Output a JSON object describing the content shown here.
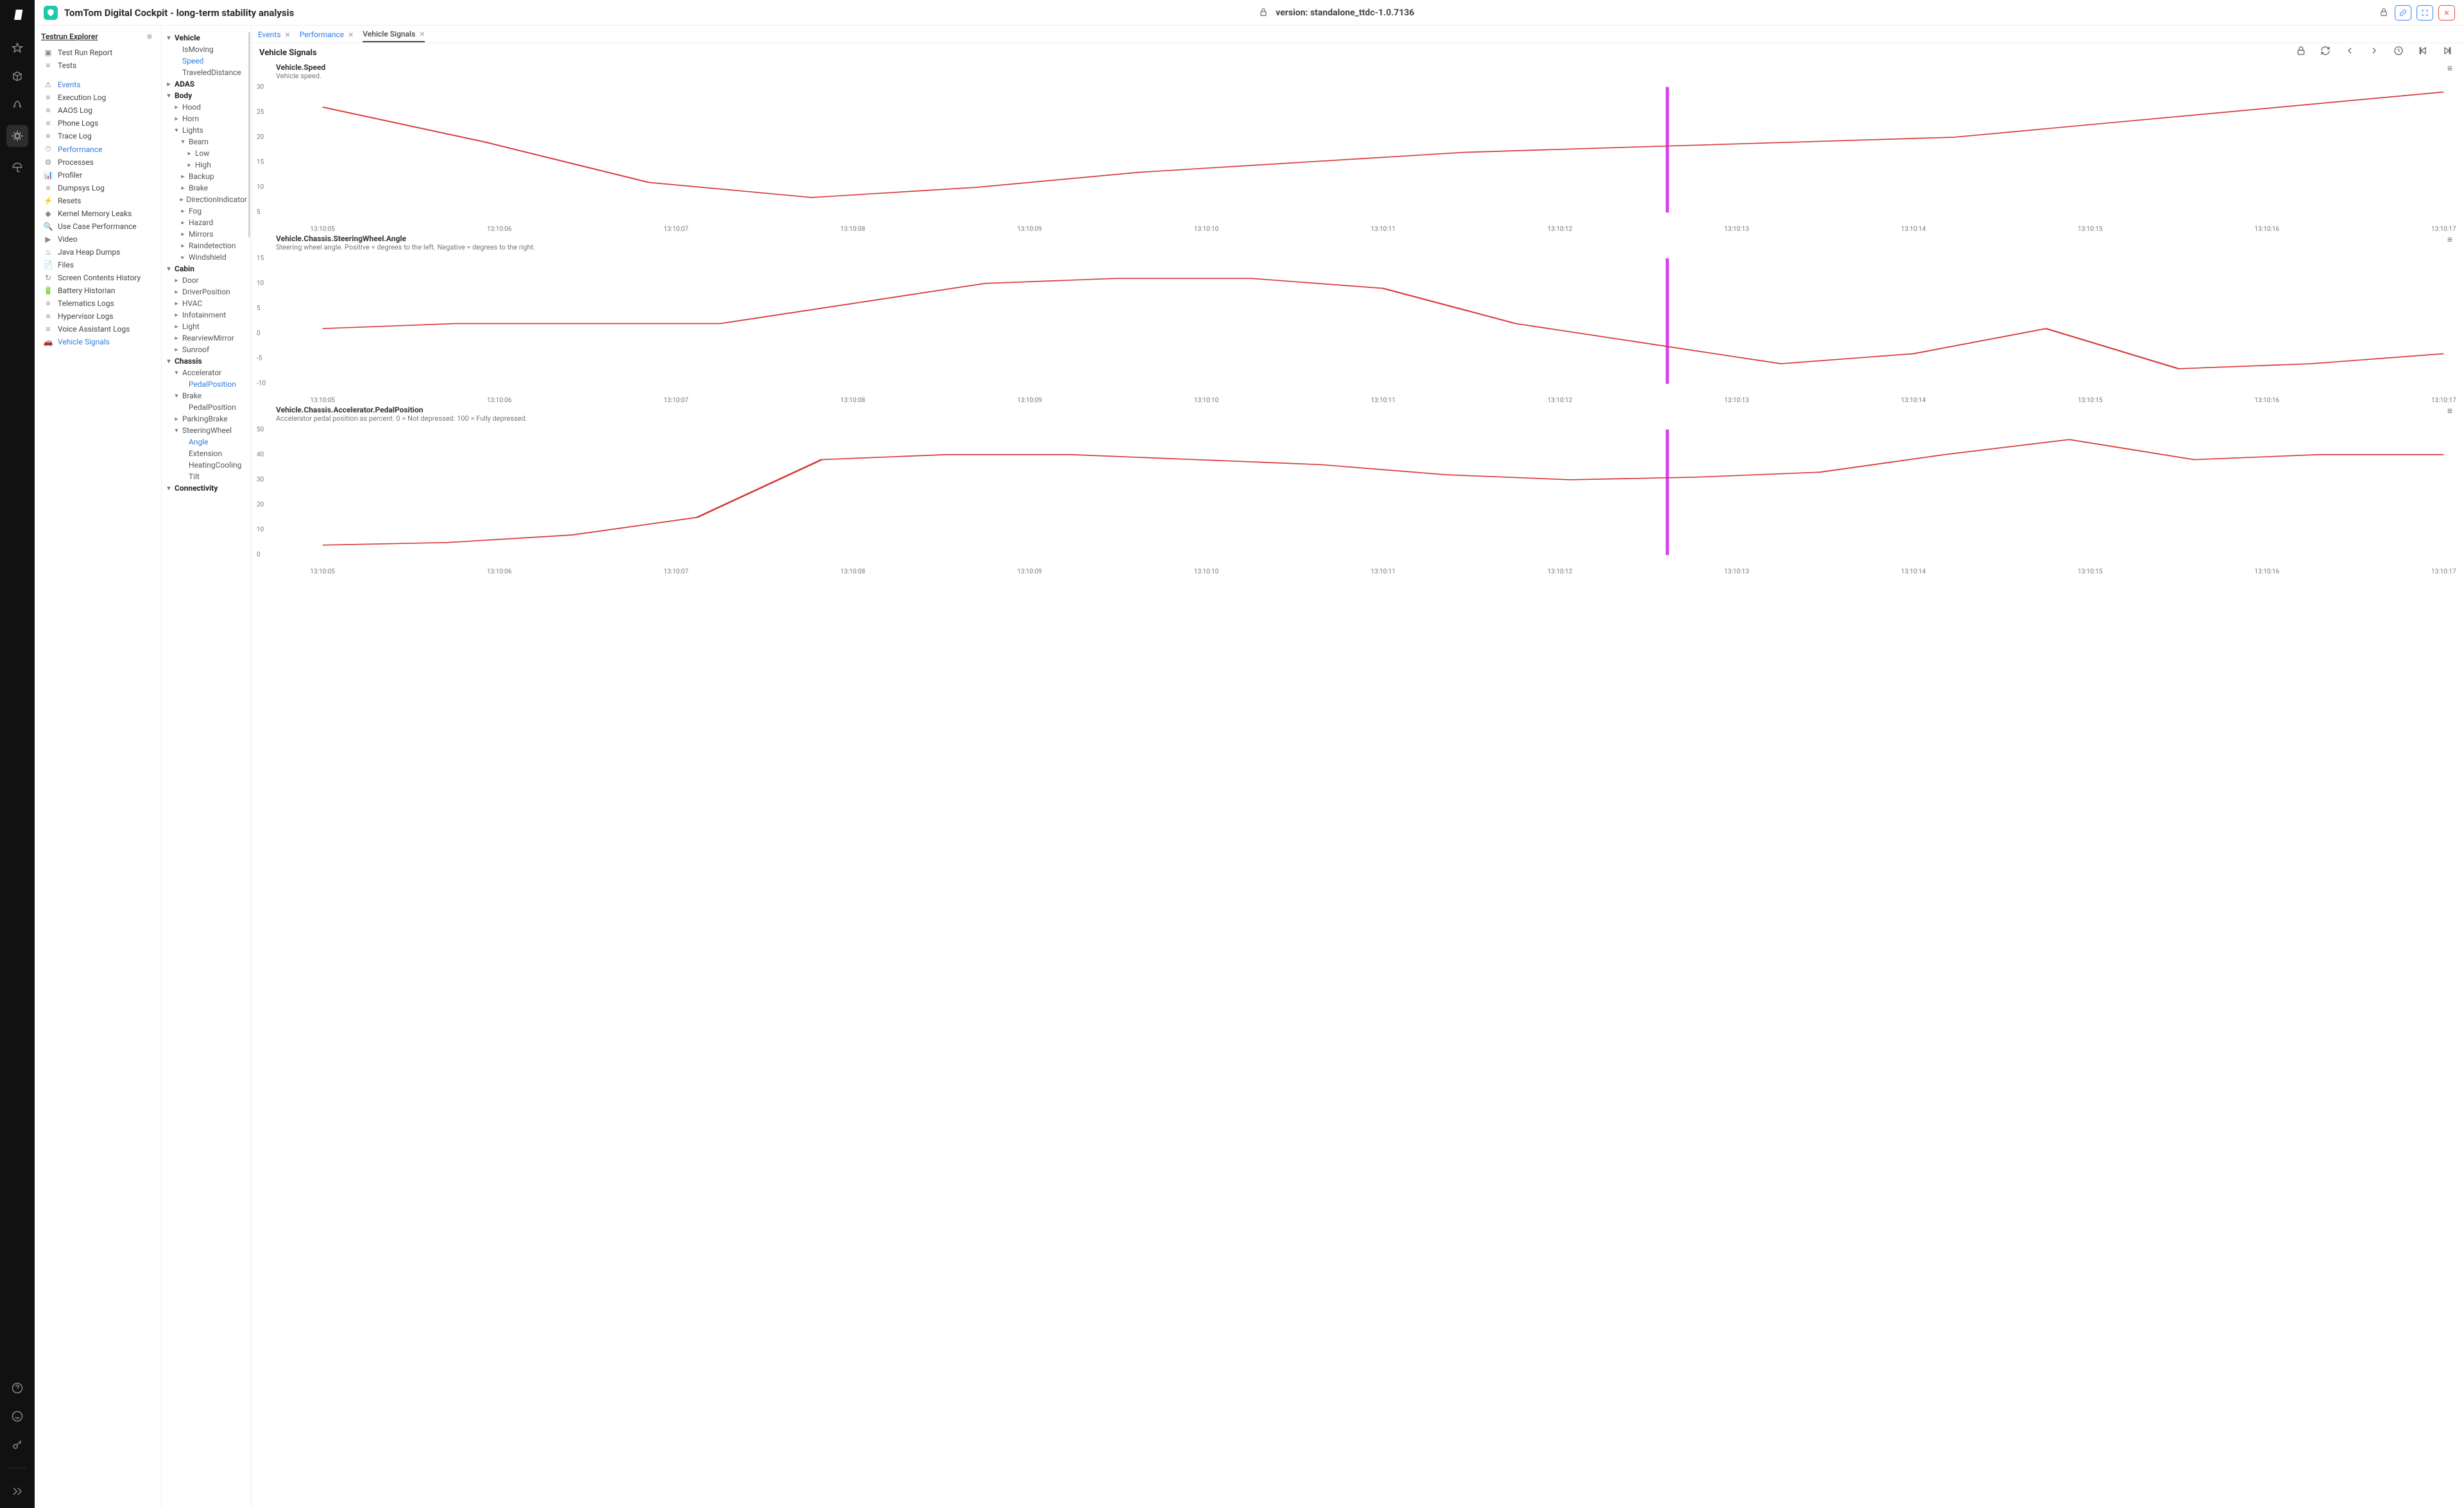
{
  "header": {
    "title": "TomTom Digital Cockpit - long-term stability analysis",
    "version": "version: standalone_ttdc-1.0.7136"
  },
  "rail_icons": [
    "star",
    "package",
    "rocket",
    "bug",
    "umbrella",
    "help",
    "smile",
    "key",
    "expand"
  ],
  "sidebar": {
    "section": "Testrun Explorer",
    "group1": [
      {
        "icon": "▣",
        "label": "Test Run Report"
      },
      {
        "icon": "≡",
        "label": "Tests"
      }
    ],
    "group2": [
      {
        "icon": "⚠",
        "label": "Events",
        "active": true
      },
      {
        "icon": "≡",
        "label": "Execution Log"
      },
      {
        "icon": "≡",
        "label": "AAOS Log"
      },
      {
        "icon": "≡",
        "label": "Phone Logs"
      },
      {
        "icon": "≡",
        "label": "Trace Log"
      },
      {
        "icon": "⏱",
        "label": "Performance",
        "active": true
      },
      {
        "icon": "⚙",
        "label": "Processes"
      },
      {
        "icon": "📊",
        "label": "Profiler"
      },
      {
        "icon": "≡",
        "label": "Dumpsys Log"
      },
      {
        "icon": "⚡",
        "label": "Resets"
      },
      {
        "icon": "◆",
        "label": "Kernel Memory Leaks"
      },
      {
        "icon": "🔍",
        "label": "Use Case Performance"
      },
      {
        "icon": "▶",
        "label": "Video"
      },
      {
        "icon": "♨",
        "label": "Java Heap Dumps"
      },
      {
        "icon": "📄",
        "label": "Files"
      },
      {
        "icon": "↻",
        "label": "Screen Contents History"
      },
      {
        "icon": "🔋",
        "label": "Battery Historian"
      },
      {
        "icon": "≡",
        "label": "Telematics Logs"
      },
      {
        "icon": "≡",
        "label": "Hypervisor Logs"
      },
      {
        "icon": "≡",
        "label": "Voice Assistant Logs"
      },
      {
        "icon": "🚗",
        "label": "Vehicle Signals",
        "active": true
      }
    ]
  },
  "tabs": [
    {
      "label": "Events",
      "active": false
    },
    {
      "label": "Performance",
      "active": false
    },
    {
      "label": "Vehicle Signals",
      "active": true
    }
  ],
  "section_title": "Vehicle Signals",
  "tree": [
    {
      "l": 0,
      "exp": "▾",
      "label": "Vehicle",
      "bold": true
    },
    {
      "l": 1,
      "exp": "",
      "label": "IsMoving"
    },
    {
      "l": 1,
      "exp": "",
      "label": "Speed",
      "active": true
    },
    {
      "l": 1,
      "exp": "",
      "label": "TraveledDistance"
    },
    {
      "l": 0,
      "exp": "▸",
      "label": "ADAS",
      "bold": true
    },
    {
      "l": 0,
      "exp": "▾",
      "label": "Body",
      "bold": true
    },
    {
      "l": 1,
      "exp": "▸",
      "label": "Hood"
    },
    {
      "l": 1,
      "exp": "▸",
      "label": "Horn"
    },
    {
      "l": 1,
      "exp": "▾",
      "label": "Lights"
    },
    {
      "l": 2,
      "exp": "▾",
      "label": "Beam"
    },
    {
      "l": 3,
      "exp": "▸",
      "label": "Low"
    },
    {
      "l": 3,
      "exp": "▸",
      "label": "High"
    },
    {
      "l": 2,
      "exp": "▸",
      "label": "Backup"
    },
    {
      "l": 2,
      "exp": "▸",
      "label": "Brake"
    },
    {
      "l": 2,
      "exp": "▸",
      "label": "DirectionIndicator"
    },
    {
      "l": 2,
      "exp": "▸",
      "label": "Fog"
    },
    {
      "l": 2,
      "exp": "▸",
      "label": "Hazard"
    },
    {
      "l": 2,
      "exp": "▸",
      "label": "Mirrors"
    },
    {
      "l": 2,
      "exp": "▸",
      "label": "Raindetection"
    },
    {
      "l": 2,
      "exp": "▸",
      "label": "Windshield"
    },
    {
      "l": 0,
      "exp": "▾",
      "label": "Cabin",
      "bold": true
    },
    {
      "l": 1,
      "exp": "▸",
      "label": "Door"
    },
    {
      "l": 1,
      "exp": "▸",
      "label": "DriverPosition"
    },
    {
      "l": 1,
      "exp": "▸",
      "label": "HVAC"
    },
    {
      "l": 1,
      "exp": "▸",
      "label": "Infotainment"
    },
    {
      "l": 1,
      "exp": "▸",
      "label": "Light"
    },
    {
      "l": 1,
      "exp": "▸",
      "label": "RearviewMirror"
    },
    {
      "l": 1,
      "exp": "▸",
      "label": "Sunroof"
    },
    {
      "l": 0,
      "exp": "▾",
      "label": "Chassis",
      "bold": true
    },
    {
      "l": 1,
      "exp": "▾",
      "label": "Accelerator"
    },
    {
      "l": 2,
      "exp": "",
      "label": "PedalPosition",
      "active": true
    },
    {
      "l": 1,
      "exp": "▾",
      "label": "Brake"
    },
    {
      "l": 2,
      "exp": "",
      "label": "PedalPosition"
    },
    {
      "l": 1,
      "exp": "▸",
      "label": "ParkingBrake"
    },
    {
      "l": 1,
      "exp": "▾",
      "label": "SteeringWheel"
    },
    {
      "l": 2,
      "exp": "",
      "label": "Angle",
      "active": true
    },
    {
      "l": 2,
      "exp": "",
      "label": "Extension"
    },
    {
      "l": 2,
      "exp": "",
      "label": "HeatingCooling"
    },
    {
      "l": 2,
      "exp": "",
      "label": "Tilt"
    },
    {
      "l": 0,
      "exp": "▾",
      "label": "Connectivity",
      "bold": true
    }
  ],
  "x_labels": [
    "13:10:05",
    "13:10:06",
    "13:10:07",
    "13:10:08",
    "13:10:09",
    "13:10:10",
    "13:10:11",
    "13:10:12",
    "13:10:13",
    "13:10:14",
    "13:10:15",
    "13:10:16",
    "13:10:17"
  ],
  "cursor_x_frac": 0.634,
  "chart_data": [
    {
      "type": "line",
      "title": "Vehicle.Speed",
      "subtitle": "Vehicle speed.",
      "ylim": [
        5,
        30
      ],
      "yticks": [
        5,
        10,
        15,
        20,
        25,
        30
      ],
      "x": [
        "13:10:05",
        "13:10:06",
        "13:10:07",
        "13:10:08",
        "13:10:09",
        "13:10:10",
        "13:10:11",
        "13:10:12",
        "13:10:13",
        "13:10:14",
        "13:10:15",
        "13:10:16",
        "13:10:17"
      ],
      "values": [
        26,
        19,
        11,
        8,
        10,
        13,
        15,
        17,
        18,
        19,
        20,
        23,
        26,
        29
      ]
    },
    {
      "type": "line",
      "title": "Vehicle.Chassis.SteeringWheel.Angle",
      "subtitle": "Steering wheel angle. Positive = degrees to the left. Negative = degrees to the right.",
      "ylim": [
        -10,
        15
      ],
      "yticks": [
        -10,
        -5,
        0,
        5,
        10,
        15
      ],
      "x": [
        "13:10:05",
        "13:10:06",
        "13:10:07",
        "13:10:08",
        "13:10:09",
        "13:10:10",
        "13:10:11",
        "13:10:12",
        "13:10:13",
        "13:10:14",
        "13:10:15",
        "13:10:16",
        "13:10:17"
      ],
      "values": [
        1,
        2,
        2,
        2,
        6,
        10,
        11,
        11,
        9,
        2,
        -2,
        -6,
        -4,
        1,
        -7,
        -6,
        -4
      ]
    },
    {
      "type": "line",
      "title": "Vehicle.Chassis.Accelerator.PedalPosition",
      "subtitle": "Accelerator pedal position as percent. 0 = Not depressed. 100 = Fully depressed.",
      "ylim": [
        0,
        50
      ],
      "yticks": [
        0,
        10,
        20,
        30,
        40,
        50
      ],
      "x": [
        "13:10:05",
        "13:10:06",
        "13:10:07",
        "13:10:08",
        "13:10:09",
        "13:10:10",
        "13:10:11",
        "13:10:12",
        "13:10:13",
        "13:10:14",
        "13:10:15",
        "13:10:16",
        "13:10:17"
      ],
      "values": [
        4,
        5,
        8,
        15,
        38,
        40,
        40,
        38,
        36,
        32,
        30,
        31,
        33,
        40,
        46,
        38,
        40,
        40
      ]
    }
  ]
}
